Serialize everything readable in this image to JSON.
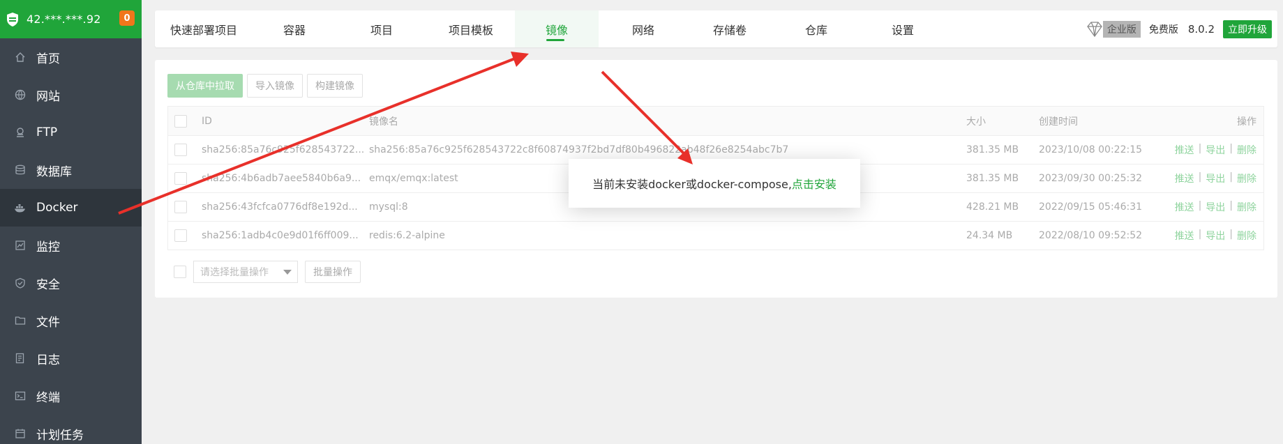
{
  "sidebar": {
    "ip": "42.***.***.92",
    "badge_count": "0",
    "items": [
      {
        "label": "首页",
        "icon": "home-icon"
      },
      {
        "label": "网站",
        "icon": "globe-icon"
      },
      {
        "label": "FTP",
        "icon": "ftp-icon"
      },
      {
        "label": "数据库",
        "icon": "database-icon"
      },
      {
        "label": "Docker",
        "icon": "docker-icon"
      },
      {
        "label": "监控",
        "icon": "monitor-icon"
      },
      {
        "label": "安全",
        "icon": "shield-icon"
      },
      {
        "label": "文件",
        "icon": "folder-icon"
      },
      {
        "label": "日志",
        "icon": "log-icon"
      },
      {
        "label": "终端",
        "icon": "terminal-icon"
      },
      {
        "label": "计划任务",
        "icon": "calendar-icon"
      }
    ],
    "active": "Docker"
  },
  "tabs": [
    {
      "label": "快速部署项目"
    },
    {
      "label": "容器"
    },
    {
      "label": "项目"
    },
    {
      "label": "项目模板"
    },
    {
      "label": "镜像"
    },
    {
      "label": "网络"
    },
    {
      "label": "存储卷"
    },
    {
      "label": "仓库"
    },
    {
      "label": "设置"
    }
  ],
  "active_tab": "镜像",
  "header_right": {
    "enterprise": "企业版",
    "free": "免费版",
    "version": "8.0.2",
    "upgrade": "立即升级"
  },
  "toolbar": {
    "pull": "从仓库中拉取",
    "import": "导入镜像",
    "build": "构建镜像"
  },
  "table": {
    "headers": {
      "id": "ID",
      "name": "镜像名",
      "size": "大小",
      "created": "创建时间",
      "ops": "操作"
    },
    "rows": [
      {
        "id": "sha256:85a76c925f628543722...",
        "name": "sha256:85a76c925f628543722c8f60874937f2bd7df80b496822ab48f26e8254abc7b7",
        "size": "381.35 MB",
        "created": "2023/10/08 00:22:15"
      },
      {
        "id": "sha256:4b6adb7aee5840b6a9...",
        "name": "emqx/emqx:latest",
        "size": "381.35 MB",
        "created": "2023/09/30 00:25:32"
      },
      {
        "id": "sha256:43fcfca0776df8e192d...",
        "name": "mysql:8",
        "size": "428.21 MB",
        "created": "2022/09/15 05:46:31"
      },
      {
        "id": "sha256:1adb4c0e9d01f6ff009...",
        "name": "redis:6.2-alpine",
        "size": "24.34 MB",
        "created": "2022/08/10 09:52:52"
      }
    ],
    "ops": {
      "push": "推送",
      "export": "导出",
      "delete": "删除",
      "sep": "|"
    }
  },
  "batch": {
    "placeholder": "请选择批量操作",
    "button": "批量操作"
  },
  "dialog": {
    "text": "当前未安装docker或docker-compose,",
    "link": "点击安装"
  },
  "colors": {
    "brand": "#20a53a",
    "sidebar": "#3c444d",
    "badge": "#f0761b",
    "annotation": "#e8302a"
  }
}
